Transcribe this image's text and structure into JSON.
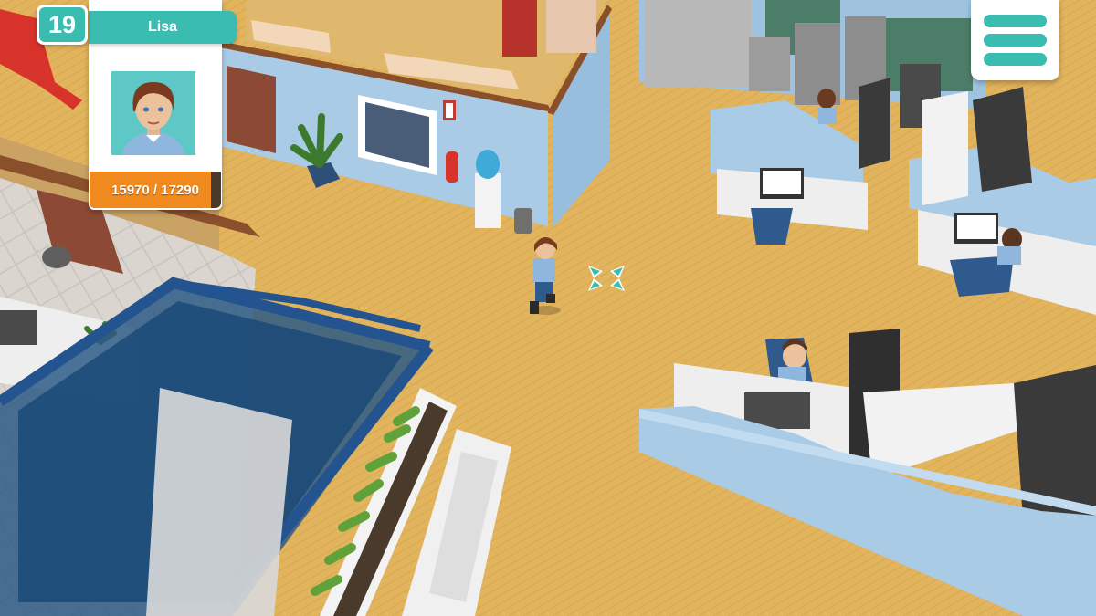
{
  "hud": {
    "level": "19",
    "player_name": "Lisa",
    "xp_text": "15970 / 17290",
    "xp_current": 15970,
    "xp_max": 17290
  },
  "menu": {
    "icon": "hamburger-menu-icon"
  },
  "colors": {
    "accent": "#3bbcb1",
    "xp_fill": "#f0891e",
    "floor": "#e2b45e",
    "wall": "#a9cbe6"
  }
}
